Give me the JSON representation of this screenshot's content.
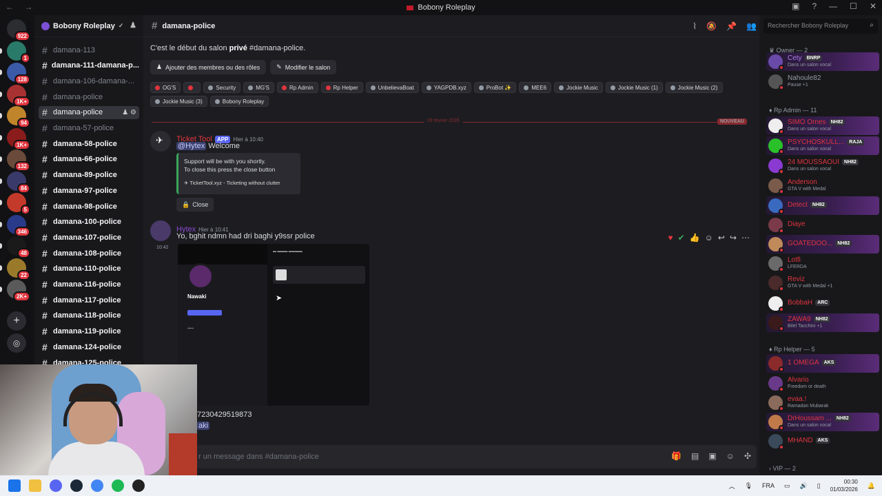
{
  "window": {
    "title": "Bobony Roleplay"
  },
  "servers": [
    {
      "color": "#2b2d31",
      "badge": "922",
      "icon": "discord-home-icon"
    },
    {
      "color": "#2a7a6a",
      "badge": "1",
      "icon": "server-icon"
    },
    {
      "color": "#3b5aa8",
      "badge": "128",
      "icon": "server-icon"
    },
    {
      "color": "#a83232",
      "badge": "1K+",
      "icon": "server-icon"
    },
    {
      "color": "#c0842a",
      "badge": "94",
      "icon": "server-icon"
    },
    {
      "color": "#8a1c1c",
      "badge": "1K+",
      "icon": "server-icon"
    },
    {
      "color": "#6a4a3a",
      "badge": "132",
      "icon": "server-icon"
    },
    {
      "color": "#3a3a6a",
      "badge": "84",
      "icon": "server-icon"
    },
    {
      "color": "#c43a2a",
      "badge": "5",
      "icon": "server-icon"
    },
    {
      "color": "#2a3a8a",
      "badge": "346",
      "icon": "server-icon"
    },
    {
      "color": "#1a1a1a",
      "badge": "48",
      "icon": "server-icon"
    },
    {
      "color": "#9a7a2a",
      "badge": "22",
      "icon": "server-icon"
    },
    {
      "color": "#5a5a5a",
      "badge": "2K+",
      "icon": "server-icon"
    }
  ],
  "guild": {
    "name": "Bobony Roleplay"
  },
  "channels": [
    {
      "name": "damana-113",
      "state": "muted"
    },
    {
      "name": "damana-111-damana-p...",
      "state": "unread"
    },
    {
      "name": "damana-106-damana-...",
      "state": "muted"
    },
    {
      "name": "damana-police",
      "state": "muted"
    },
    {
      "name": "damana-police",
      "state": "active"
    },
    {
      "name": "damana-57-police",
      "state": "muted"
    },
    {
      "name": "damana-58-police",
      "state": "unread"
    },
    {
      "name": "damana-66-police",
      "state": "unread"
    },
    {
      "name": "damana-89-police",
      "state": "unread"
    },
    {
      "name": "damana-97-police",
      "state": "unread"
    },
    {
      "name": "damana-98-police",
      "state": "unread"
    },
    {
      "name": "damana-100-police",
      "state": "unread"
    },
    {
      "name": "damana-107-police",
      "state": "unread"
    },
    {
      "name": "damana-108-police",
      "state": "unread"
    },
    {
      "name": "damana-110-police",
      "state": "unread"
    },
    {
      "name": "damana-116-police",
      "state": "unread"
    },
    {
      "name": "damana-117-police",
      "state": "unread"
    },
    {
      "name": "damana-118-police",
      "state": "unread"
    },
    {
      "name": "damana-119-police",
      "state": "unread"
    },
    {
      "name": "damana-124-police",
      "state": "unread"
    },
    {
      "name": "damana-125-police",
      "state": "unread"
    }
  ],
  "header": {
    "channel": "damana-police"
  },
  "intro": {
    "prefix": "C'est le début du salon ",
    "bold": "privé",
    "suffix": " #damana-police."
  },
  "buttons": {
    "add_members": "Ajouter des membres ou des rôles",
    "edit_channel": "Modifier le salon"
  },
  "roles": [
    {
      "name": "OG'S",
      "color": "#e0353e"
    },
    {
      "name": "",
      "color": "#e0353e"
    },
    {
      "name": "Security",
      "color": "#949ba4"
    },
    {
      "name": "MG'S",
      "color": "#949ba4"
    },
    {
      "name": "Rp Admin",
      "color": "#e0353e"
    },
    {
      "name": "Rp Helper",
      "color": "#e0353e"
    },
    {
      "name": "UnbelievaBoat",
      "color": "#949ba4"
    },
    {
      "name": "YAGPDB.xyz",
      "color": "#949ba4"
    },
    {
      "name": "ProBot ✨",
      "color": "#949ba4"
    },
    {
      "name": "MEE6",
      "color": "#949ba4"
    },
    {
      "name": "Jockie Music",
      "color": "#949ba4"
    },
    {
      "name": "Jockie Music (1)",
      "color": "#949ba4"
    },
    {
      "name": "Jockie Music (2)",
      "color": "#949ba4"
    },
    {
      "name": "Jockie Music (3)",
      "color": "#949ba4"
    },
    {
      "name": "Bobony Roleplay",
      "color": "#949ba4"
    }
  ],
  "divider": {
    "date": "28 février 2026",
    "new": "NOUVEAU"
  },
  "msg1": {
    "author": "Ticket Tool",
    "app": "APP",
    "time": "Hier à 10:40",
    "mention": "@Hytex",
    "text": " Welcome",
    "embed_line1": "Support will be with you shortly.",
    "embed_line2": "To close this press the close button",
    "embed_footer": "TicketTool.xyz - Ticketing without clutter",
    "button": "Close"
  },
  "msg2": {
    "author": "Hytex",
    "time": "Hier à 10:41",
    "text": "Yo, bghit ndmn had dri baghi y9ssr police",
    "side_time": "10:42",
    "shot_name": "Nawaki",
    "tail1": "7230429519873",
    "tail2": "aki"
  },
  "composer": {
    "placeholder": "r un message dans #damana-police"
  },
  "search": {
    "placeholder": "Rechercher Bobony Roleplay"
  },
  "sections": {
    "owner": "Owner — 2",
    "admin": "Rp Admin — 11",
    "helper": "Rp Helper — 5",
    "vip": "VIP — 2"
  },
  "members": [
    {
      "name": "Cety",
      "color": "#b07cf0",
      "tag": "BNRP",
      "activity": "Dans un salon vocal",
      "boost": true,
      "av": "#6a4aa8"
    },
    {
      "name": "Nahoule82",
      "color": "#949ba4",
      "tag": "",
      "activity": "Pause +1",
      "boost": false,
      "av": "#555"
    },
    {
      "name": "SIMO Ornes",
      "color": "#e0353e",
      "tag": "NH82",
      "activity": "Dans un salon vocal",
      "boost": true,
      "av": "#eee"
    },
    {
      "name": "PSYCHOSKULL...",
      "color": "#e0353e",
      "tag": "RAJA",
      "activity": "Dans un salon vocal",
      "boost": true,
      "av": "#2ac02a"
    },
    {
      "name": "24 MOUSSAOUI",
      "color": "#e0353e",
      "tag": "NH82",
      "activity": "Dans un salon vocal",
      "boost": false,
      "av": "#8a3ad0"
    },
    {
      "name": "Anderson",
      "color": "#e0353e",
      "tag": "",
      "activity": "GTA V with Medal",
      "boost": false,
      "av": "#7a5a4a"
    },
    {
      "name": "Detect",
      "color": "#e0353e",
      "tag": "NH82",
      "activity": "",
      "boost": true,
      "av": "#3a6ac0"
    },
    {
      "name": "Diaye",
      "color": "#e0353e",
      "tag": "",
      "activity": "",
      "boost": false,
      "av": "#7a3a4a"
    },
    {
      "name": "GOATEDOO...",
      "color": "#e0353e",
      "tag": "NH82",
      "activity": "",
      "boost": true,
      "av": "#c08a5a"
    },
    {
      "name": "Lotfi",
      "color": "#e0353e",
      "tag": "",
      "activity": "LFERDA",
      "boost": false,
      "av": "#6a6a6a"
    },
    {
      "name": "Reviz",
      "color": "#e0353e",
      "tag": "",
      "activity": "GTA V with Medal +1",
      "boost": false,
      "av": "#4a2a2a"
    },
    {
      "name": "BobbaH",
      "color": "#e0353e",
      "tag": "ARC",
      "activity": "",
      "boost": false,
      "av": "#eee"
    },
    {
      "name": "ZAWA9",
      "color": "#e0353e",
      "tag": "NH82",
      "activity": "Bilel Tacchini +1",
      "boost": true,
      "av": "#3a1a1a"
    },
    {
      "name": "1 OMEGA",
      "color": "#e0353e",
      "tag": "AKS",
      "activity": "",
      "boost": true,
      "av": "#8a2a2a"
    },
    {
      "name": "Alvario",
      "color": "#e0353e",
      "tag": "",
      "activity": "Freedom or death",
      "boost": false,
      "av": "#6a3a8a"
    },
    {
      "name": "evaa.!",
      "color": "#e0353e",
      "tag": "",
      "activity": "Ramadan Mubarak",
      "boost": false,
      "av": "#8a6a5a"
    },
    {
      "name": "DrHoussam ...",
      "color": "#e0353e",
      "tag": "NH82",
      "activity": "Dans un salon vocal",
      "boost": true,
      "av": "#c07a4a"
    },
    {
      "name": "MHAND",
      "color": "#e0353e",
      "tag": "AKS",
      "activity": "",
      "boost": false,
      "av": "#3a4a5a"
    }
  ],
  "tray": {
    "lang": "FRA",
    "time": "00:30",
    "date": "01/03/2026"
  }
}
